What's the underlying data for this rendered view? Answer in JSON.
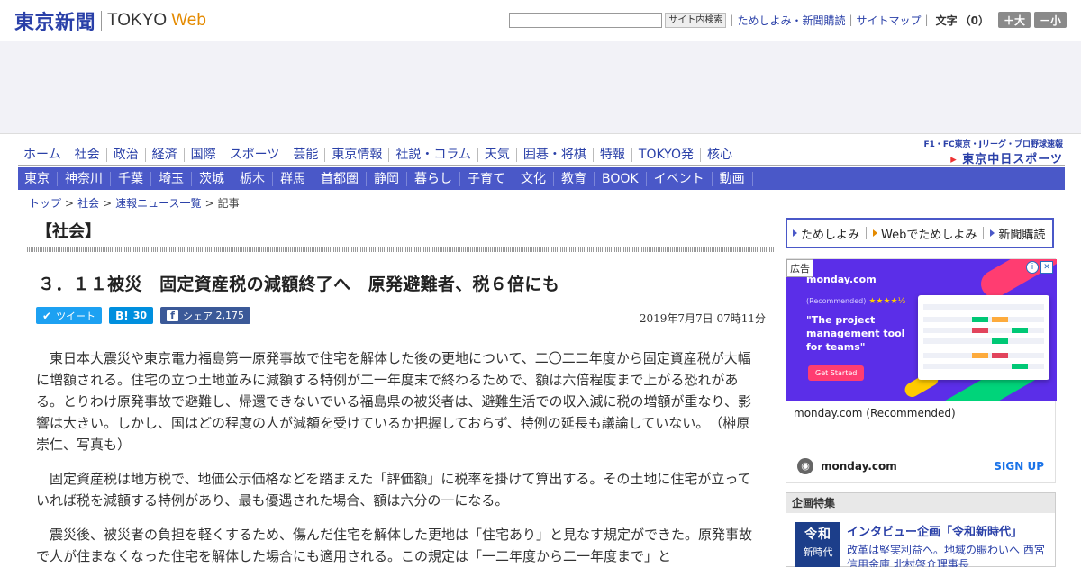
{
  "header": {
    "logo_kanji": "東京新聞",
    "logo_tokyo": "TOKYO",
    "logo_web": "Web",
    "search_button": "サイト内検索",
    "links": [
      "ためしよみ・新聞購読",
      "サイトマップ"
    ],
    "font_size_label": "文字",
    "font_size_count": "（0）",
    "enlarge_button": "＋大",
    "shrink_button": "－小"
  },
  "nav_main": [
    "ホーム",
    "社会",
    "政治",
    "経済",
    "国際",
    "スポーツ",
    "芸能",
    "東京情報",
    "社説・コラム",
    "天気",
    "囲碁・将棋",
    "特報",
    "TOKYO発",
    "核心"
  ],
  "chunichi": {
    "line1": "F1・FC東京・Jリーグ・プロ野球速報",
    "line2": "東京中日スポーツ"
  },
  "nav_sub": [
    "東京",
    "神奈川",
    "千葉",
    "埼玉",
    "茨城",
    "栃木",
    "群馬",
    "首都圏",
    "静岡",
    "暮らし",
    "子育て",
    "文化",
    "教育",
    "BOOK",
    "イベント",
    "動画"
  ],
  "breadcrumb": {
    "items": [
      "トップ",
      "社会",
      "速報ニュース一覧"
    ],
    "current": "記事"
  },
  "article": {
    "category": "【社会】",
    "headline": "３．１１被災　固定資産税の減額終了へ　原発避難者、税６倍にも",
    "date": "2019年7月7日 07時11分",
    "share": {
      "tweet": "ツイート",
      "hatena_count": "30",
      "facebook": "シェア",
      "facebook_count": "2,175"
    },
    "paragraphs": [
      "東日本大震災や東京電力福島第一原発事故で住宅を解体した後の更地について、二〇二二年度から固定資産税が大幅に増額される。住宅の立つ土地並みに減額する特例が二一年度末で終わるためで、額は六倍程度まで上がる恐れがある。とりわけ原発事故で避難し、帰還できないでいる福島県の被災者は、避難生活での収入減に税の増額が重なり、影響は大きい。しかし、国はどの程度の人が減額を受けているか把握しておらず、特例の延長も議論していない。　（榊原崇仁、写真も）",
      "固定資産税は地方税で、地価公示価格などを踏まえた「評価額」に税率を掛けて算出する。その土地に住宅が立っていれば税を減額する特例があり、最も優遇された場合、額は六分の一になる。",
      "震災後、被災者の負担を軽くするため、傷んだ住宅を解体した更地は「住宅あり」と見なす規定ができた。原発事故で人が住まなくなった住宅を解体した場合にも適用される。この規定は「一二年度から二一年度まで」と"
    ]
  },
  "sidebar": {
    "links": [
      "ためしよみ",
      "Webでためしよみ",
      "新聞購読"
    ],
    "ad": {
      "label": "広告",
      "brand": "monday.com",
      "recommended": "(Recommended)",
      "stars": "★★★★½",
      "quote": "\"The project management tool for teams\"",
      "cta": "Get Started",
      "title": "monday.com (Recommended)",
      "domain": "monday.com",
      "signup": "SIGN UP"
    },
    "special": {
      "heading": "企画特集",
      "thumb_line1": "令和",
      "thumb_line2": "新時代",
      "title": "インタビュー企画「令和新時代」",
      "desc": "改革は堅実利益へ。地域の賑わいへ 西宮信用金庫 北村啓介理事長"
    }
  },
  "colors": {
    "brand_blue": "#2a40a8",
    "nav_sub_bg": "#4a58c8",
    "web_orange": "#e48a00",
    "twitter": "#1da1f2",
    "hatena": "#008fde",
    "facebook": "#3b5998",
    "ad_purple": "#5b2ee8"
  }
}
